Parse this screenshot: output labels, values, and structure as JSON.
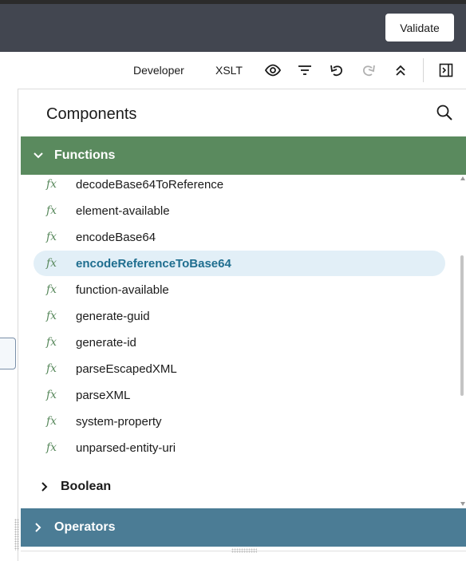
{
  "header": {
    "validate_label": "Validate"
  },
  "toolbar": {
    "developer_label": "Developer",
    "xslt_label": "XSLT",
    "icons": [
      "eye-icon",
      "filter-icon",
      "undo-icon",
      "redo-icon",
      "collapse-all-icon",
      "panel-toggle-icon"
    ]
  },
  "panel": {
    "title": "Components",
    "sections": {
      "functions": {
        "label": "Functions",
        "color": "#5a8a5e",
        "expanded": true,
        "items": [
          {
            "label": "decodeBase64ToReference",
            "icon": "fx"
          },
          {
            "label": "element-available",
            "icon": "fx"
          },
          {
            "label": "encodeBase64",
            "icon": "fx"
          },
          {
            "label": "encodeReferenceToBase64",
            "icon": "fx"
          },
          {
            "label": "function-available",
            "icon": "fx"
          },
          {
            "label": "generate-guid",
            "icon": "fx"
          },
          {
            "label": "generate-id",
            "icon": "fx"
          },
          {
            "label": "parseEscapedXML",
            "icon": "fx"
          },
          {
            "label": "parseXML",
            "icon": "fx"
          },
          {
            "label": "system-property",
            "icon": "fx"
          },
          {
            "label": "unparsed-entity-uri",
            "icon": "fx"
          }
        ]
      },
      "boolean": {
        "label": "Boolean",
        "expanded": false
      },
      "operators": {
        "label": "Operators",
        "color": "#4b7c95",
        "expanded": false
      }
    }
  },
  "colors": {
    "header_bg": "#424650",
    "selected_bg": "#e2eff7",
    "selected_text": "#1f6e8f"
  }
}
